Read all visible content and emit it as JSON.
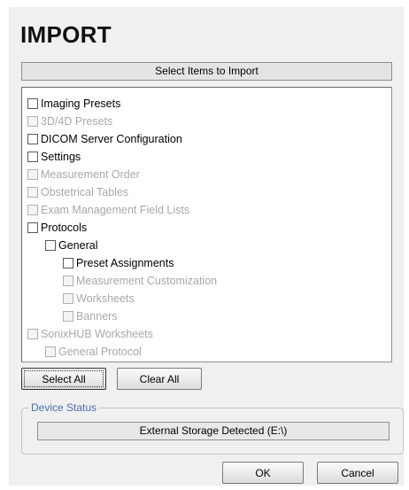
{
  "dialog": {
    "title": "IMPORT",
    "section_header": "Select Items to Import"
  },
  "items": [
    {
      "label": "Imaging Presets",
      "enabled": true,
      "checked": false
    },
    {
      "label": "3D/4D Presets",
      "enabled": false,
      "checked": false
    },
    {
      "label": "DICOM Server Configuration",
      "enabled": true,
      "checked": false
    },
    {
      "label": "Settings",
      "enabled": true,
      "checked": false
    },
    {
      "label": "Measurement Order",
      "enabled": false,
      "checked": false
    },
    {
      "label": "Obstetrical Tables",
      "enabled": false,
      "checked": false
    },
    {
      "label": "Exam Management Field Lists",
      "enabled": false,
      "checked": false
    },
    {
      "label": "Protocols",
      "enabled": true,
      "checked": false
    },
    {
      "label": "General",
      "enabled": true,
      "checked": false
    },
    {
      "label": "Preset Assignments",
      "enabled": true,
      "checked": false
    },
    {
      "label": "Measurement Customization",
      "enabled": false,
      "checked": false
    },
    {
      "label": "Worksheets",
      "enabled": false,
      "checked": false
    },
    {
      "label": "Banners",
      "enabled": false,
      "checked": false
    },
    {
      "label": "SonixHUB Worksheets",
      "enabled": false,
      "checked": false
    },
    {
      "label": "General Protocol",
      "enabled": false,
      "checked": false
    }
  ],
  "buttons": {
    "select_all": "Select All",
    "clear_all": "Clear All",
    "ok": "OK",
    "cancel": "Cancel"
  },
  "device_status": {
    "legend": "Device Status",
    "text": "External Storage Detected (E:\\)"
  }
}
